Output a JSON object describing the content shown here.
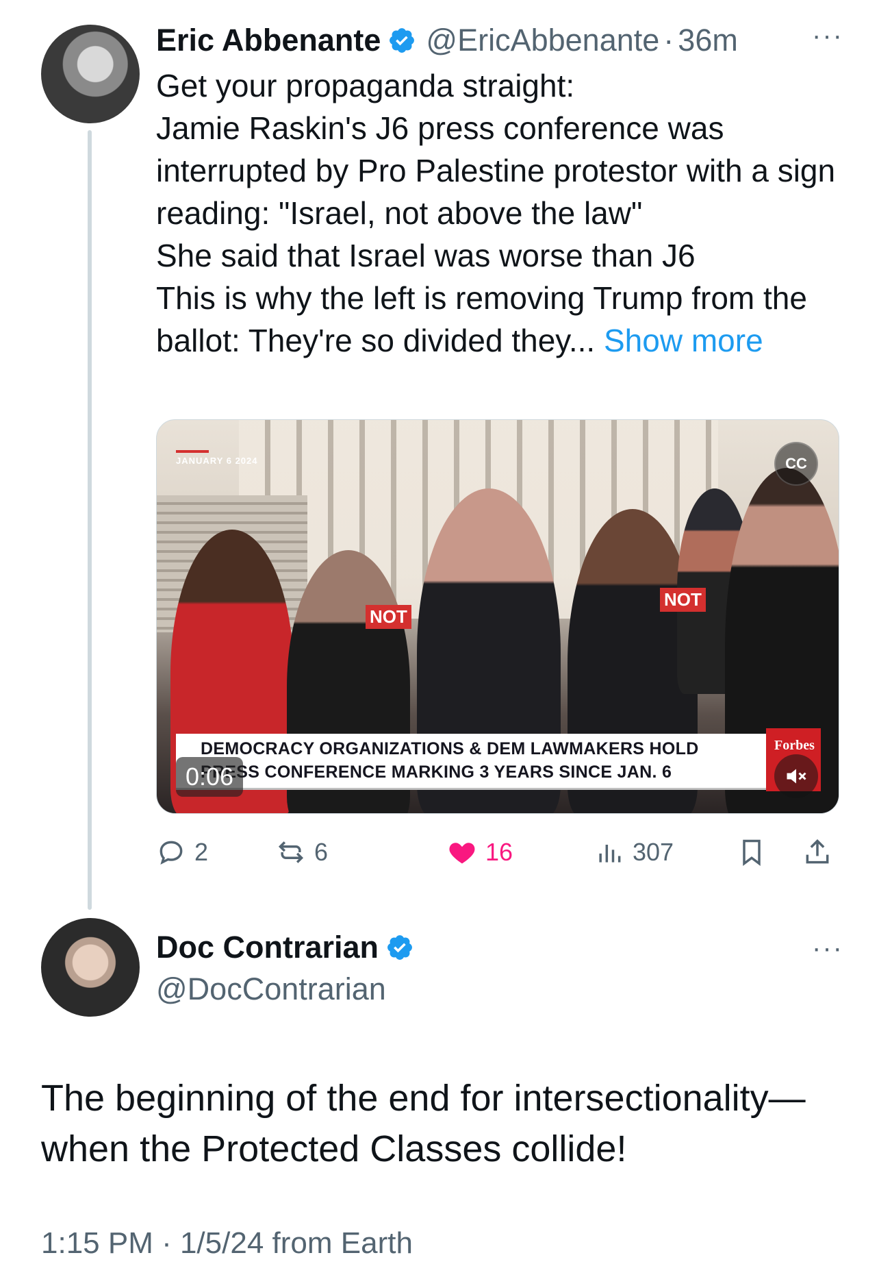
{
  "parent_tweet": {
    "author_name": "Eric Abbenante",
    "handle": "@EricAbbenante",
    "separator": "·",
    "time": "36m",
    "more": "···",
    "text": "Get your propaganda straight:\nJamie Raskin's J6 press conference was interrupted by Pro Palestine protestor with a sign reading: \"Israel, not above the law\"\nShe said that Israel was worse than J6\nThis is why the left is removing Trump from the ballot: They're so divided they... ",
    "show_more": "Show more",
    "media": {
      "date_tag": "JANUARY 6 2024",
      "sign_a": "NOT",
      "sign_b": "NOT",
      "lower_third_line1": "DEMOCRACY ORGANIZATIONS & DEM LAWMAKERS HOLD",
      "lower_third_line2": "PRESS CONFERENCE MARKING 3 YEARS SINCE JAN. 6",
      "network": "Forbes",
      "cc_label": "CC",
      "timer": "0:06"
    },
    "actions": {
      "replies": "2",
      "reposts": "6",
      "likes": "16",
      "views": "307"
    },
    "colors": {
      "like": "#f91880",
      "link": "#1d9bf0",
      "verified": "#1d9bf0"
    }
  },
  "main_tweet": {
    "author_name": "Doc Contrarian",
    "handle": "@DocContrarian",
    "more": "···",
    "text": "The beginning of the end for intersectionality—\nwhen the Protected Classes collide!",
    "meta": "1:15 PM · 1/5/24 from Earth"
  }
}
